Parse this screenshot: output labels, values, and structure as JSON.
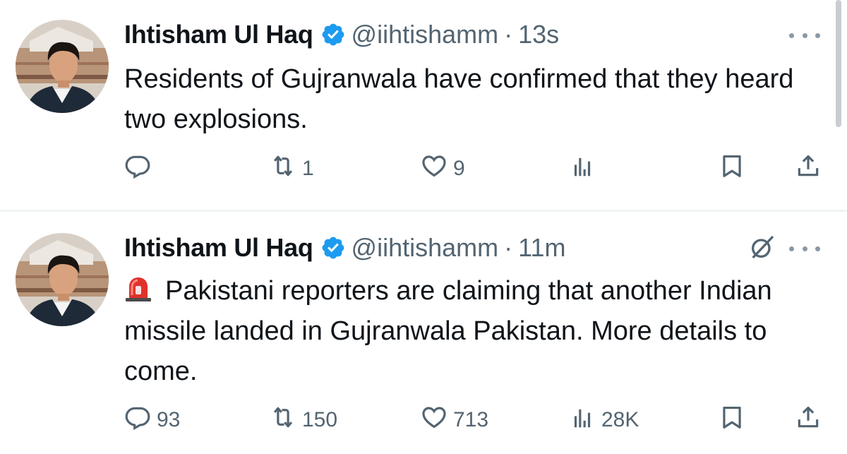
{
  "colors": {
    "text": "#0f1419",
    "muted": "#536471",
    "verified": "#1d9bf0",
    "divider": "#eff3f4"
  },
  "tweets": [
    {
      "author_name": "Ihtisham Ul Haq",
      "verified": true,
      "handle": "@iihtishamm",
      "separator": "·",
      "time": "13s",
      "text": "Residents of Gujranwala have confirmed that they heard two explosions.",
      "has_emoji": false,
      "icons": {
        "reply": "reply-icon",
        "retweet": "retweet-icon",
        "like": "heart-icon",
        "views": "views-icon",
        "bookmark": "bookmark-icon",
        "share": "share-icon"
      },
      "counts": {
        "reply": "",
        "retweet": "1",
        "like": "9",
        "views": ""
      }
    },
    {
      "author_name": "Ihtisham Ul Haq",
      "verified": true,
      "handle": "@iihtishamm",
      "separator": "·",
      "time": "11m",
      "text": "Pakistani reporters are claiming that another Indian missile landed in Gujranwala Pakistan. More details to come.",
      "has_emoji": true,
      "emoji": "siren-icon",
      "icons": {
        "grok": "grok-icon",
        "reply": "reply-icon",
        "retweet": "retweet-icon",
        "like": "heart-icon",
        "views": "views-icon",
        "bookmark": "bookmark-icon",
        "share": "share-icon"
      },
      "counts": {
        "reply": "93",
        "retweet": "150",
        "like": "713",
        "views": "28K"
      }
    }
  ]
}
